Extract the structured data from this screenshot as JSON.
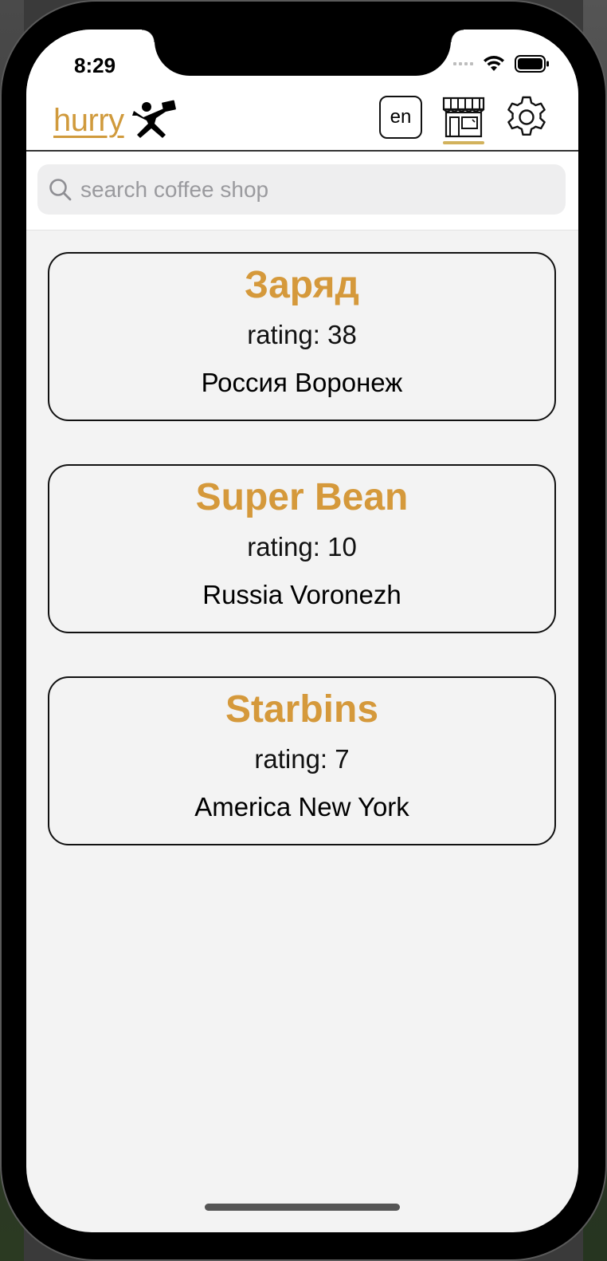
{
  "status_bar": {
    "time": "8:29"
  },
  "header": {
    "logo_text": "hurry",
    "language_label": "en",
    "accent_color": "#d5993b"
  },
  "search": {
    "placeholder": "search coffee shop",
    "value": ""
  },
  "shops": [
    {
      "name": "Заряд",
      "rating": "rating: 38",
      "location": "Россия Воронеж"
    },
    {
      "name": "Super Bean",
      "rating": "rating: 10",
      "location": "Russia Voronezh"
    },
    {
      "name": "Starbins",
      "rating": "rating: 7",
      "location": "America New York"
    }
  ],
  "icons": {
    "runner": "runner-logo-icon",
    "shop": "shop-icon",
    "settings": "gear-icon",
    "search": "search-icon"
  }
}
